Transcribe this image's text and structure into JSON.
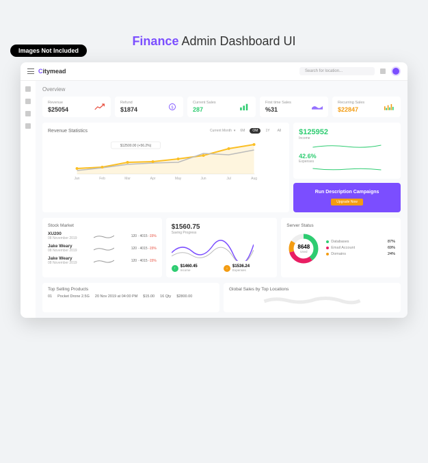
{
  "badge": "Images Not Included",
  "title_purple": "Finance",
  "title_rest": " Admin Dashboard UI",
  "brand": "itymead",
  "search_placeholder": "Search for location...",
  "overview": "Overview",
  "stats": [
    {
      "label": "Revenue",
      "value": "$25054"
    },
    {
      "label": "Refund",
      "value": "$1874"
    },
    {
      "label": "Current Sales",
      "value": "287"
    },
    {
      "label": "First time Sales",
      "value": "%31"
    },
    {
      "label": "Recurring Sales",
      "value": "$22847"
    }
  ],
  "revenue": {
    "title": "Revenue Statistics",
    "dropdown": "Current Month",
    "tabs": [
      "6M",
      "OM",
      "1Y",
      "All"
    ],
    "tooltip": "$12500.00 (+56.2%)"
  },
  "income": {
    "value": "$125952",
    "label": "Income",
    "expense_pct": "42.6%",
    "expense_label": "Expenses"
  },
  "promo": {
    "title": "Run Description Campaigns",
    "btn": "Upgrade Now"
  },
  "stock": {
    "title": "Stock Market",
    "items": [
      {
        "name": "XU200",
        "date": "08 November 2019",
        "val": "120 · 4015",
        "pct": "-15%"
      },
      {
        "name": "Jake Weary",
        "date": "08 November 2019",
        "val": "120 · 4015",
        "pct": "-15%"
      },
      {
        "name": "Jake Weary",
        "date": "08 November 2019",
        "val": "120 · 4015",
        "pct": "-15%"
      }
    ]
  },
  "saving": {
    "value": "$1560.75",
    "label": "Saving Progress",
    "income": "$1460.45",
    "income_label": "Income",
    "expense": "$1536.24",
    "expense_label": "Expenses"
  },
  "server": {
    "title": "Server Status",
    "center_val": "8648",
    "center_label": "Used",
    "items": [
      {
        "label": "Databases",
        "pct": "87%",
        "color": "#2ecc71"
      },
      {
        "label": "Email Account",
        "pct": "69%",
        "color": "#e91e63"
      },
      {
        "label": "Domains",
        "pct": "24%",
        "color": "#f39c12"
      }
    ]
  },
  "products": {
    "title": "Top Selling Products",
    "row": {
      "id": "01",
      "name": "Pocket Drone 2.5G",
      "date": "20 Nov 2019 at 04:00 PM",
      "price": "$15.00",
      "qty": "16 Qty",
      "total": "$2800.00"
    }
  },
  "global": {
    "title": "Global Sales by Top Locations"
  },
  "chart_data": {
    "type": "line",
    "categories": [
      "Jan",
      "Feb",
      "Mar",
      "Apr",
      "May",
      "Jun",
      "Jul",
      "Aug"
    ],
    "series": [
      {
        "name": "orange",
        "values": [
          7000,
          7500,
          9000,
          9200,
          10000,
          11000,
          12500,
          13800
        ]
      },
      {
        "name": "gray",
        "values": [
          5500,
          6500,
          8200,
          8800,
          9000,
          11800,
          11000,
          12200
        ]
      }
    ],
    "ylim": [
      0,
      15000
    ]
  }
}
